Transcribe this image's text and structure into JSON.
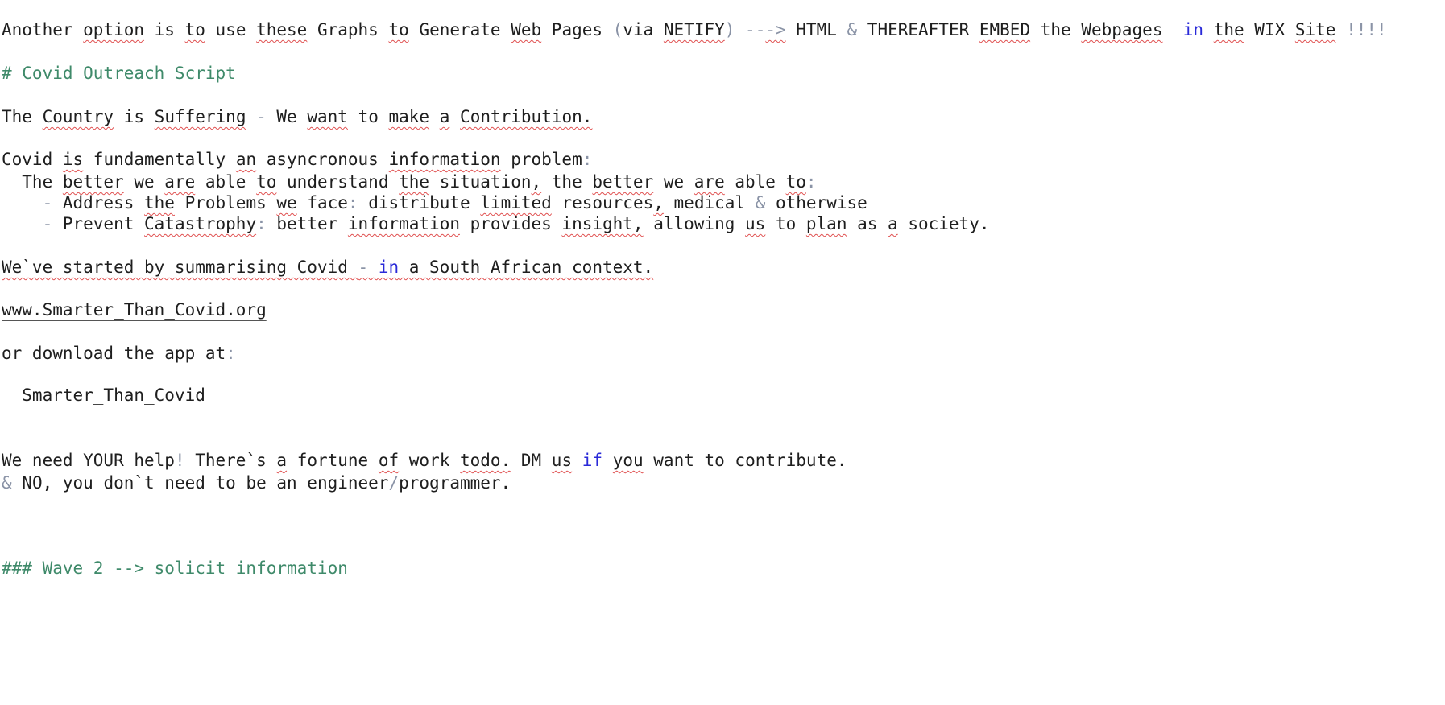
{
  "editor": {
    "lines": [
      [
        {
          "t": "Another "
        },
        {
          "t": "option",
          "c": "sq"
        },
        {
          "t": " is "
        },
        {
          "t": "to",
          "c": "sq"
        },
        {
          "t": " use "
        },
        {
          "t": "these",
          "c": "sq"
        },
        {
          "t": " Graphs "
        },
        {
          "t": "to",
          "c": "sq"
        },
        {
          "t": " Generate "
        },
        {
          "t": "Web",
          "c": "sq"
        },
        {
          "t": " Pages "
        },
        {
          "t": "(",
          "c": "op"
        },
        {
          "t": "via "
        },
        {
          "t": "NETIFY",
          "c": "sq"
        },
        {
          "t": ") --",
          "c": "op"
        },
        {
          "t": "->",
          "c": "op sq"
        },
        {
          "t": " HTML "
        },
        {
          "t": "&",
          "c": "op"
        },
        {
          "t": " THEREAFTER "
        },
        {
          "t": "EMBED",
          "c": "sq"
        },
        {
          "t": " the "
        },
        {
          "t": "Webpages",
          "c": "sq"
        },
        {
          "t": "  "
        },
        {
          "t": "in",
          "c": "kw"
        },
        {
          "t": " "
        },
        {
          "t": "the",
          "c": "sq"
        },
        {
          "t": " WIX "
        },
        {
          "t": "Site",
          "c": "sq"
        },
        {
          "t": " !!!!",
          "c": "op"
        }
      ],
      [
        {
          "t": "# Covid Outreach Script",
          "c": "heading"
        }
      ],
      [
        {
          "t": "The "
        },
        {
          "t": "Country",
          "c": "sq"
        },
        {
          "t": " is "
        },
        {
          "t": "Suffering",
          "c": "sq"
        },
        {
          "t": " - ",
          "c": "op"
        },
        {
          "t": "We "
        },
        {
          "t": "want",
          "c": "sq"
        },
        {
          "t": " to "
        },
        {
          "t": "make",
          "c": "sq"
        },
        {
          "t": " "
        },
        {
          "t": "a",
          "c": "sq"
        },
        {
          "t": " "
        },
        {
          "t": "Contribution.",
          "c": "sq"
        }
      ],
      [
        {
          "t": "Covid "
        },
        {
          "t": "is",
          "c": "sq"
        },
        {
          "t": " fundamentally "
        },
        {
          "t": "an",
          "c": "sq"
        },
        {
          "t": " asyncronous "
        },
        {
          "t": "information",
          "c": "sq"
        },
        {
          "t": " problem"
        },
        {
          "t": ":",
          "c": "op"
        }
      ],
      [
        {
          "t": "  The "
        },
        {
          "t": "better",
          "c": "sq"
        },
        {
          "t": " we "
        },
        {
          "t": "are",
          "c": "sq"
        },
        {
          "t": " able "
        },
        {
          "t": "to",
          "c": "sq"
        },
        {
          "t": " understand "
        },
        {
          "t": "the",
          "c": "sq"
        },
        {
          "t": " situation"
        },
        {
          "t": ",",
          "c": "sq"
        },
        {
          "t": " the "
        },
        {
          "t": "better",
          "c": "sq"
        },
        {
          "t": " we "
        },
        {
          "t": "are",
          "c": "sq"
        },
        {
          "t": " able "
        },
        {
          "t": "to",
          "c": "sq"
        },
        {
          "t": ":",
          "c": "op"
        }
      ],
      [
        {
          "t": "    - ",
          "c": "op"
        },
        {
          "t": "Address "
        },
        {
          "t": "the",
          "c": "sq"
        },
        {
          "t": " Problems "
        },
        {
          "t": "we",
          "c": "sq"
        },
        {
          "t": " face"
        },
        {
          "t": ":",
          "c": "op"
        },
        {
          "t": " distribute "
        },
        {
          "t": "limited",
          "c": "sq"
        },
        {
          "t": " resources"
        },
        {
          "t": ",",
          "c": "sq"
        },
        {
          "t": " medical "
        },
        {
          "t": "&",
          "c": "op"
        },
        {
          "t": " otherwise"
        }
      ],
      [
        {
          "t": "    - ",
          "c": "op"
        },
        {
          "t": "Prevent "
        },
        {
          "t": "Catastrophy",
          "c": "sq"
        },
        {
          "t": ":",
          "c": "op"
        },
        {
          "t": " better "
        },
        {
          "t": "information",
          "c": "sq"
        },
        {
          "t": " provides "
        },
        {
          "t": "insight,",
          "c": "sq"
        },
        {
          "t": " allowing "
        },
        {
          "t": "us",
          "c": "sq"
        },
        {
          "t": " to "
        },
        {
          "t": "plan",
          "c": "sq"
        },
        {
          "t": " as "
        },
        {
          "t": "a",
          "c": "sq"
        },
        {
          "t": " society."
        }
      ],
      [
        {
          "t": "We`ve started by summarising Covid ",
          "c": "sq"
        },
        {
          "t": "- ",
          "c": "op sq"
        },
        {
          "t": "in",
          "c": "kw sq"
        },
        {
          "t": " a South African context.",
          "c": "sq"
        }
      ],
      [
        {
          "t": "www.Smarter_Than_Covid.org",
          "c": "link"
        }
      ],
      [
        {
          "t": "or download the app at"
        },
        {
          "t": ":",
          "c": "op"
        }
      ],
      [
        {
          "t": "  Smarter_Than_Covid"
        }
      ],
      [
        {
          "t": "We need YOUR help"
        },
        {
          "t": "!",
          "c": "op"
        },
        {
          "t": " There`s "
        },
        {
          "t": "a",
          "c": "sq"
        },
        {
          "t": " fortune "
        },
        {
          "t": "of",
          "c": "sq"
        },
        {
          "t": " work "
        },
        {
          "t": "todo.",
          "c": "sq"
        },
        {
          "t": " DM "
        },
        {
          "t": "us",
          "c": "sq"
        },
        {
          "t": " "
        },
        {
          "t": "if",
          "c": "kw"
        },
        {
          "t": " "
        },
        {
          "t": "you",
          "c": "sq"
        },
        {
          "t": " want to contribute."
        }
      ],
      [
        {
          "t": "&",
          "c": "op"
        },
        {
          "t": " NO, you don`t need to be an engineer"
        },
        {
          "t": "/",
          "c": "op"
        },
        {
          "t": "programmer."
        }
      ],
      [
        {
          "t": "### Wave 2 --> solicit information",
          "c": "heading"
        }
      ]
    ]
  }
}
